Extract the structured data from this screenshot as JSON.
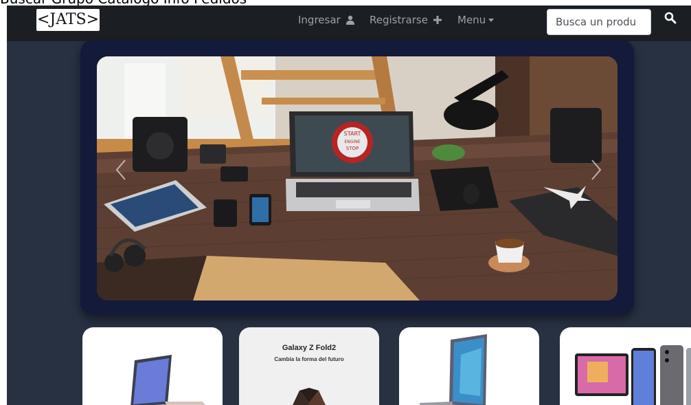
{
  "page_header_text": "Buscar  Grupo  Catalogo  Info  Pedidos",
  "navbar": {
    "brand": "<JATS>",
    "login_label": "Ingresar",
    "register_label": "Registrarse",
    "menu_label": "Menu",
    "search_placeholder": "Busca un produ",
    "icons": {
      "login": "user-icon",
      "register": "plus-icon",
      "menu": "caret-down-icon",
      "search": "search-icon"
    }
  },
  "carousel": {
    "prev_icon": "chevron-left-icon",
    "next_icon": "chevron-right-icon",
    "slide_screen_sign": [
      "START",
      "ENGINE",
      "STOP"
    ]
  },
  "products": [
    {
      "image": "laptop-photo"
    },
    {
      "image": "galaxy-z-fold2-photo",
      "title": "Galaxy Z Fold2",
      "subtitle": "Cambia la forma del futuro"
    },
    {
      "image": "laptop-photo"
    },
    {
      "image": "phones-tablet-photo"
    }
  ],
  "colors": {
    "page_background": "#273142",
    "navbar_background": "#1b1f23",
    "carousel_card": "#141a3a",
    "nav_text": "#9aa1a8"
  }
}
